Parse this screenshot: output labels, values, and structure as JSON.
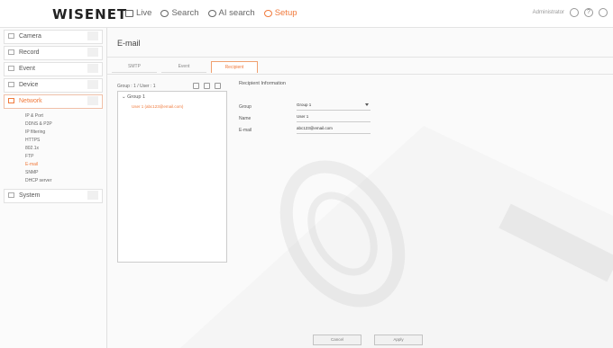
{
  "header": {
    "logo": "WISENET",
    "nav": [
      {
        "label": "Live",
        "icon": "monitor-icon",
        "active": false
      },
      {
        "label": "Search",
        "icon": "search-icon",
        "active": false
      },
      {
        "label": "AI search",
        "icon": "ai-search-icon",
        "active": false
      },
      {
        "label": "Setup",
        "icon": "gear-icon",
        "active": true
      }
    ],
    "user": "Administrator",
    "icons": [
      "user-icon",
      "help-icon",
      "power-icon"
    ]
  },
  "sidebar": {
    "items": [
      {
        "label": "Camera",
        "icon": "camera-icon"
      },
      {
        "label": "Record",
        "icon": "record-icon"
      },
      {
        "label": "Event",
        "icon": "event-icon"
      },
      {
        "label": "Device",
        "icon": "device-icon"
      },
      {
        "label": "Network",
        "icon": "network-icon",
        "active": true
      }
    ],
    "network_sub": [
      "IP & Port",
      "DDNS & P2P",
      "IP filtering",
      "HTTPS",
      "802.1x",
      "FTP",
      "E-mail",
      "SNMP",
      "DHCP server"
    ],
    "network_sub_active": "E-mail",
    "system": {
      "label": "System",
      "icon": "system-icon"
    }
  },
  "main": {
    "title": "E-mail",
    "tabs": [
      {
        "label": "SMTP",
        "active": false
      },
      {
        "label": "Event",
        "active": false
      },
      {
        "label": "Recipient",
        "active": true
      }
    ],
    "group_summary": "Group : 1 / User : 1",
    "tree": {
      "group": "Group 1",
      "user": "User 1 (abc123@email.com)"
    },
    "recipient": {
      "title": "Recipient Information",
      "group_label": "Group",
      "group_value": "Group 1",
      "name_label": "Name",
      "name_value": "User 1",
      "email_label": "E-mail",
      "email_value": "abc123@email.com"
    },
    "buttons": {
      "cancel": "Cancel",
      "apply": "Apply"
    }
  },
  "colors": {
    "accent": "#f07a3c"
  }
}
